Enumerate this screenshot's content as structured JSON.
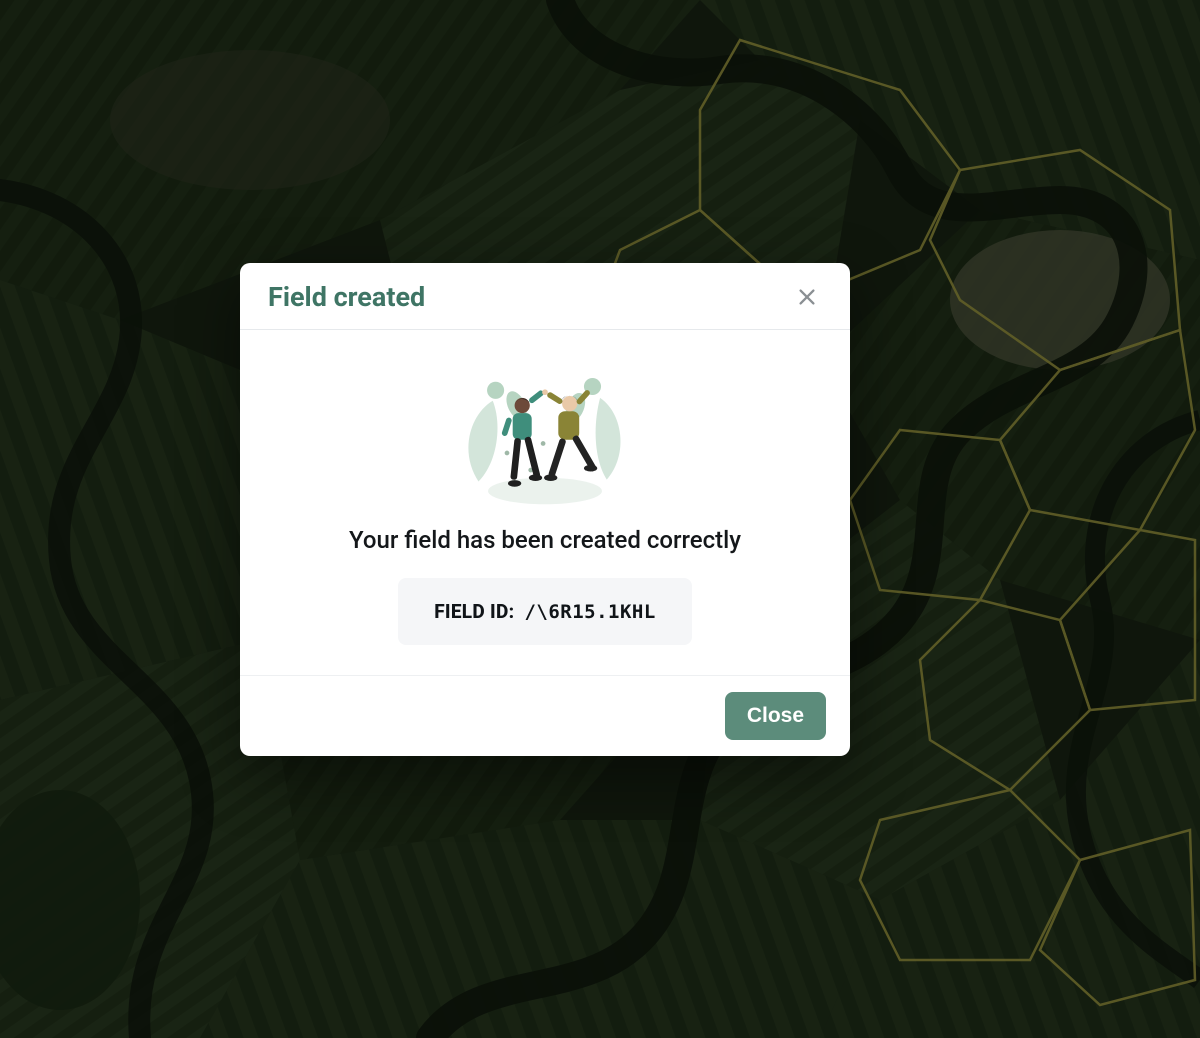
{
  "modal": {
    "title": "Field created",
    "success_message": "Your field has been created correctly",
    "field_id_label": "FIELD ID:",
    "field_id_value": "/\\6R15.1KHL",
    "close_button_label": "Close"
  },
  "colors": {
    "accent": "#3f7565",
    "button": "#5c8c7b",
    "field_box_bg": "#f5f6f8"
  }
}
